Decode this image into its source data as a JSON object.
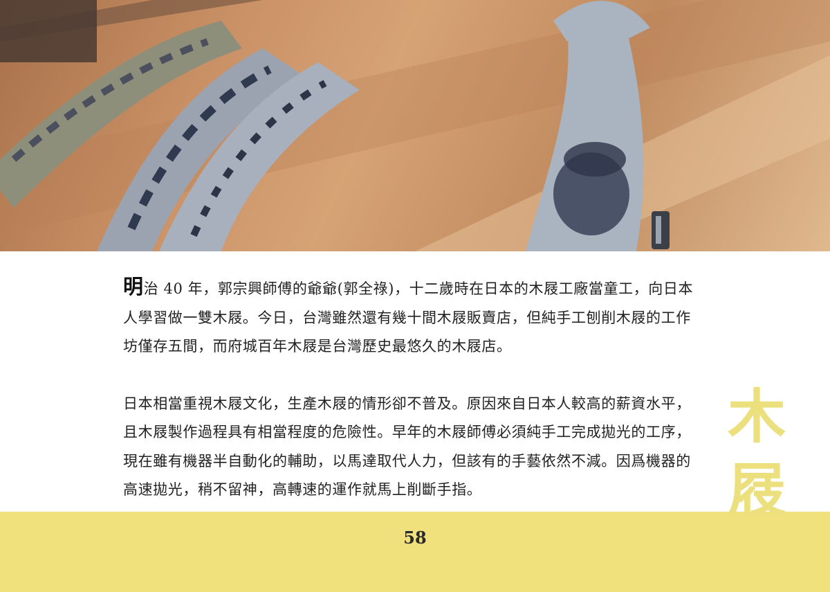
{
  "photo": {
    "description_icon": "wooden-clogs-photo-icon"
  },
  "article": {
    "drop_cap": "明",
    "paragraph1_rest": "治 40 年，郭宗興師傅的爺爺(郭全祿)，十二歲時在日本的木屐工廠當童工，向日本人學習做一雙木屐。今日，台灣雖然還有幾十間木屐販賣店，但純手工刨削木屐的工作坊僅存五間，而府城百年木屐是台灣歷史最悠久的木屐店。",
    "paragraph2": "日本相當重視木屐文化，生產木屐的情形卻不普及。原因來自日本人較高的薪資水平，且木屐製作過程具有相當程度的危險性。早年的木屐師傅必須純手工完成拋光的工序，現在雖有機器半自動化的輔助，以馬達取代人力，但該有的手藝依然不減。因爲機器的高速拋光，稍不留神，高轉速的運作就馬上削斷手指。"
  },
  "side_title": {
    "char1": "木",
    "char2": "屐"
  },
  "footer": {
    "page_number": "58"
  },
  "colors": {
    "accent_yellow": "#f0e17c",
    "side_title": "#ece07e"
  }
}
